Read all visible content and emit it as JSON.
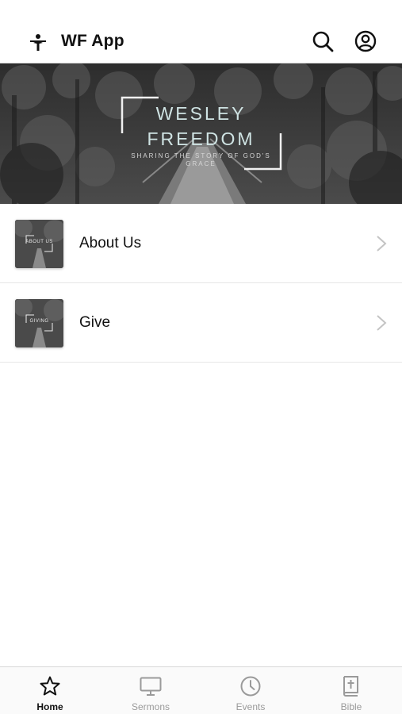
{
  "header": {
    "app_title": "WF App",
    "logo_icon": "cross-person-icon",
    "search_icon": "search-icon",
    "account_icon": "account-icon"
  },
  "banner": {
    "line1": "WESLEY",
    "line2": "FREEDOM",
    "tagline1": "SHARING THE STORY OF GOD'S",
    "tagline2": "GRACE",
    "text_color": "#cfe3e3"
  },
  "list": {
    "items": [
      {
        "label": "About Us",
        "thumb_text": "ABOUT US"
      },
      {
        "label": "Give",
        "thumb_text": "GIVING"
      }
    ]
  },
  "tabs": [
    {
      "label": "Home",
      "icon": "star-icon",
      "active": true
    },
    {
      "label": "Sermons",
      "icon": "monitor-icon",
      "active": false
    },
    {
      "label": "Events",
      "icon": "clock-icon",
      "active": false
    },
    {
      "label": "Bible",
      "icon": "bible-icon",
      "active": false
    }
  ],
  "colors": {
    "active_tab": "#111111",
    "inactive_tab": "#9a9a9a",
    "divider": "#e6e6e6"
  }
}
